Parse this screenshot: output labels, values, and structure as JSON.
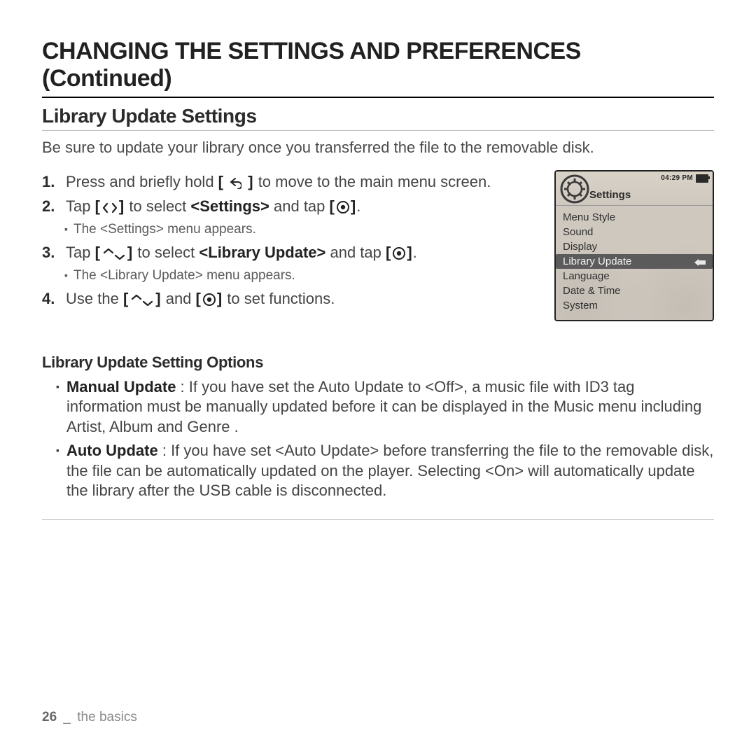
{
  "page": {
    "title": "CHANGING THE SETTINGS AND PREFERENCES (Continued)",
    "section": "Library Update Settings",
    "intro": "Be sure to update your library once you transferred the file to the removable disk.",
    "footer_page": "26",
    "footer_sep": "_",
    "footer_section": "the basics"
  },
  "steps": {
    "s1_num": "1.",
    "s1_a": "Press and briefly hold ",
    "s1_b": " to move to the main menu screen.",
    "s2_num": "2.",
    "s2_a": "Tap ",
    "s2_b": " to select ",
    "s2_c": "<Settings>",
    "s2_d": " and tap ",
    "s2_e": ".",
    "s2_sub": "The <Settings> menu appears.",
    "s3_num": "3.",
    "s3_a": "Tap ",
    "s3_b": " to select ",
    "s3_c": "<Library Update>",
    "s3_d": " and tap ",
    "s3_e": ".",
    "s3_sub": "The <Library Update> menu appears.",
    "s4_num": "4.",
    "s4_a": "Use the ",
    "s4_b": " and ",
    "s4_c": " to set functions."
  },
  "device": {
    "title": "Settings",
    "clock": "04:29 PM",
    "items": [
      "Menu Style",
      "Sound",
      "Display",
      "Library Update",
      "Language",
      "Date & Time",
      "System"
    ],
    "selected_index": 3
  },
  "options_header": "Library Update Setting Options",
  "options": {
    "o1_label": "Manual Update",
    "o1_text": " : If you have set the Auto Update to <Off>, a music file with ID3 tag information must be manually updated before it can be displayed in the Music menu including Artist, Album and Genre .",
    "o2_label": "Auto Update",
    "o2_text": " : If you have set <Auto Update> before transferring the file to the removable disk, the file can be automatically updated on the player. Selecting <On> will automatically update the library after the USB cable is disconnected."
  }
}
